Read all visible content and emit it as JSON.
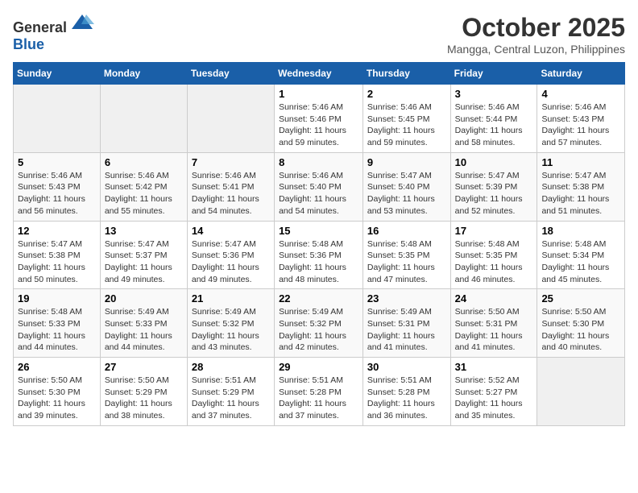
{
  "header": {
    "logo_general": "General",
    "logo_blue": "Blue",
    "month": "October 2025",
    "location": "Mangga, Central Luzon, Philippines"
  },
  "weekdays": [
    "Sunday",
    "Monday",
    "Tuesday",
    "Wednesday",
    "Thursday",
    "Friday",
    "Saturday"
  ],
  "weeks": [
    [
      {
        "day": "",
        "info": ""
      },
      {
        "day": "",
        "info": ""
      },
      {
        "day": "",
        "info": ""
      },
      {
        "day": "1",
        "info": "Sunrise: 5:46 AM\nSunset: 5:46 PM\nDaylight: 11 hours\nand 59 minutes."
      },
      {
        "day": "2",
        "info": "Sunrise: 5:46 AM\nSunset: 5:45 PM\nDaylight: 11 hours\nand 59 minutes."
      },
      {
        "day": "3",
        "info": "Sunrise: 5:46 AM\nSunset: 5:44 PM\nDaylight: 11 hours\nand 58 minutes."
      },
      {
        "day": "4",
        "info": "Sunrise: 5:46 AM\nSunset: 5:43 PM\nDaylight: 11 hours\nand 57 minutes."
      }
    ],
    [
      {
        "day": "5",
        "info": "Sunrise: 5:46 AM\nSunset: 5:43 PM\nDaylight: 11 hours\nand 56 minutes."
      },
      {
        "day": "6",
        "info": "Sunrise: 5:46 AM\nSunset: 5:42 PM\nDaylight: 11 hours\nand 55 minutes."
      },
      {
        "day": "7",
        "info": "Sunrise: 5:46 AM\nSunset: 5:41 PM\nDaylight: 11 hours\nand 54 minutes."
      },
      {
        "day": "8",
        "info": "Sunrise: 5:46 AM\nSunset: 5:40 PM\nDaylight: 11 hours\nand 54 minutes."
      },
      {
        "day": "9",
        "info": "Sunrise: 5:47 AM\nSunset: 5:40 PM\nDaylight: 11 hours\nand 53 minutes."
      },
      {
        "day": "10",
        "info": "Sunrise: 5:47 AM\nSunset: 5:39 PM\nDaylight: 11 hours\nand 52 minutes."
      },
      {
        "day": "11",
        "info": "Sunrise: 5:47 AM\nSunset: 5:38 PM\nDaylight: 11 hours\nand 51 minutes."
      }
    ],
    [
      {
        "day": "12",
        "info": "Sunrise: 5:47 AM\nSunset: 5:38 PM\nDaylight: 11 hours\nand 50 minutes."
      },
      {
        "day": "13",
        "info": "Sunrise: 5:47 AM\nSunset: 5:37 PM\nDaylight: 11 hours\nand 49 minutes."
      },
      {
        "day": "14",
        "info": "Sunrise: 5:47 AM\nSunset: 5:36 PM\nDaylight: 11 hours\nand 49 minutes."
      },
      {
        "day": "15",
        "info": "Sunrise: 5:48 AM\nSunset: 5:36 PM\nDaylight: 11 hours\nand 48 minutes."
      },
      {
        "day": "16",
        "info": "Sunrise: 5:48 AM\nSunset: 5:35 PM\nDaylight: 11 hours\nand 47 minutes."
      },
      {
        "day": "17",
        "info": "Sunrise: 5:48 AM\nSunset: 5:35 PM\nDaylight: 11 hours\nand 46 minutes."
      },
      {
        "day": "18",
        "info": "Sunrise: 5:48 AM\nSunset: 5:34 PM\nDaylight: 11 hours\nand 45 minutes."
      }
    ],
    [
      {
        "day": "19",
        "info": "Sunrise: 5:48 AM\nSunset: 5:33 PM\nDaylight: 11 hours\nand 44 minutes."
      },
      {
        "day": "20",
        "info": "Sunrise: 5:49 AM\nSunset: 5:33 PM\nDaylight: 11 hours\nand 44 minutes."
      },
      {
        "day": "21",
        "info": "Sunrise: 5:49 AM\nSunset: 5:32 PM\nDaylight: 11 hours\nand 43 minutes."
      },
      {
        "day": "22",
        "info": "Sunrise: 5:49 AM\nSunset: 5:32 PM\nDaylight: 11 hours\nand 42 minutes."
      },
      {
        "day": "23",
        "info": "Sunrise: 5:49 AM\nSunset: 5:31 PM\nDaylight: 11 hours\nand 41 minutes."
      },
      {
        "day": "24",
        "info": "Sunrise: 5:50 AM\nSunset: 5:31 PM\nDaylight: 11 hours\nand 41 minutes."
      },
      {
        "day": "25",
        "info": "Sunrise: 5:50 AM\nSunset: 5:30 PM\nDaylight: 11 hours\nand 40 minutes."
      }
    ],
    [
      {
        "day": "26",
        "info": "Sunrise: 5:50 AM\nSunset: 5:30 PM\nDaylight: 11 hours\nand 39 minutes."
      },
      {
        "day": "27",
        "info": "Sunrise: 5:50 AM\nSunset: 5:29 PM\nDaylight: 11 hours\nand 38 minutes."
      },
      {
        "day": "28",
        "info": "Sunrise: 5:51 AM\nSunset: 5:29 PM\nDaylight: 11 hours\nand 37 minutes."
      },
      {
        "day": "29",
        "info": "Sunrise: 5:51 AM\nSunset: 5:28 PM\nDaylight: 11 hours\nand 37 minutes."
      },
      {
        "day": "30",
        "info": "Sunrise: 5:51 AM\nSunset: 5:28 PM\nDaylight: 11 hours\nand 36 minutes."
      },
      {
        "day": "31",
        "info": "Sunrise: 5:52 AM\nSunset: 5:27 PM\nDaylight: 11 hours\nand 35 minutes."
      },
      {
        "day": "",
        "info": ""
      }
    ]
  ]
}
